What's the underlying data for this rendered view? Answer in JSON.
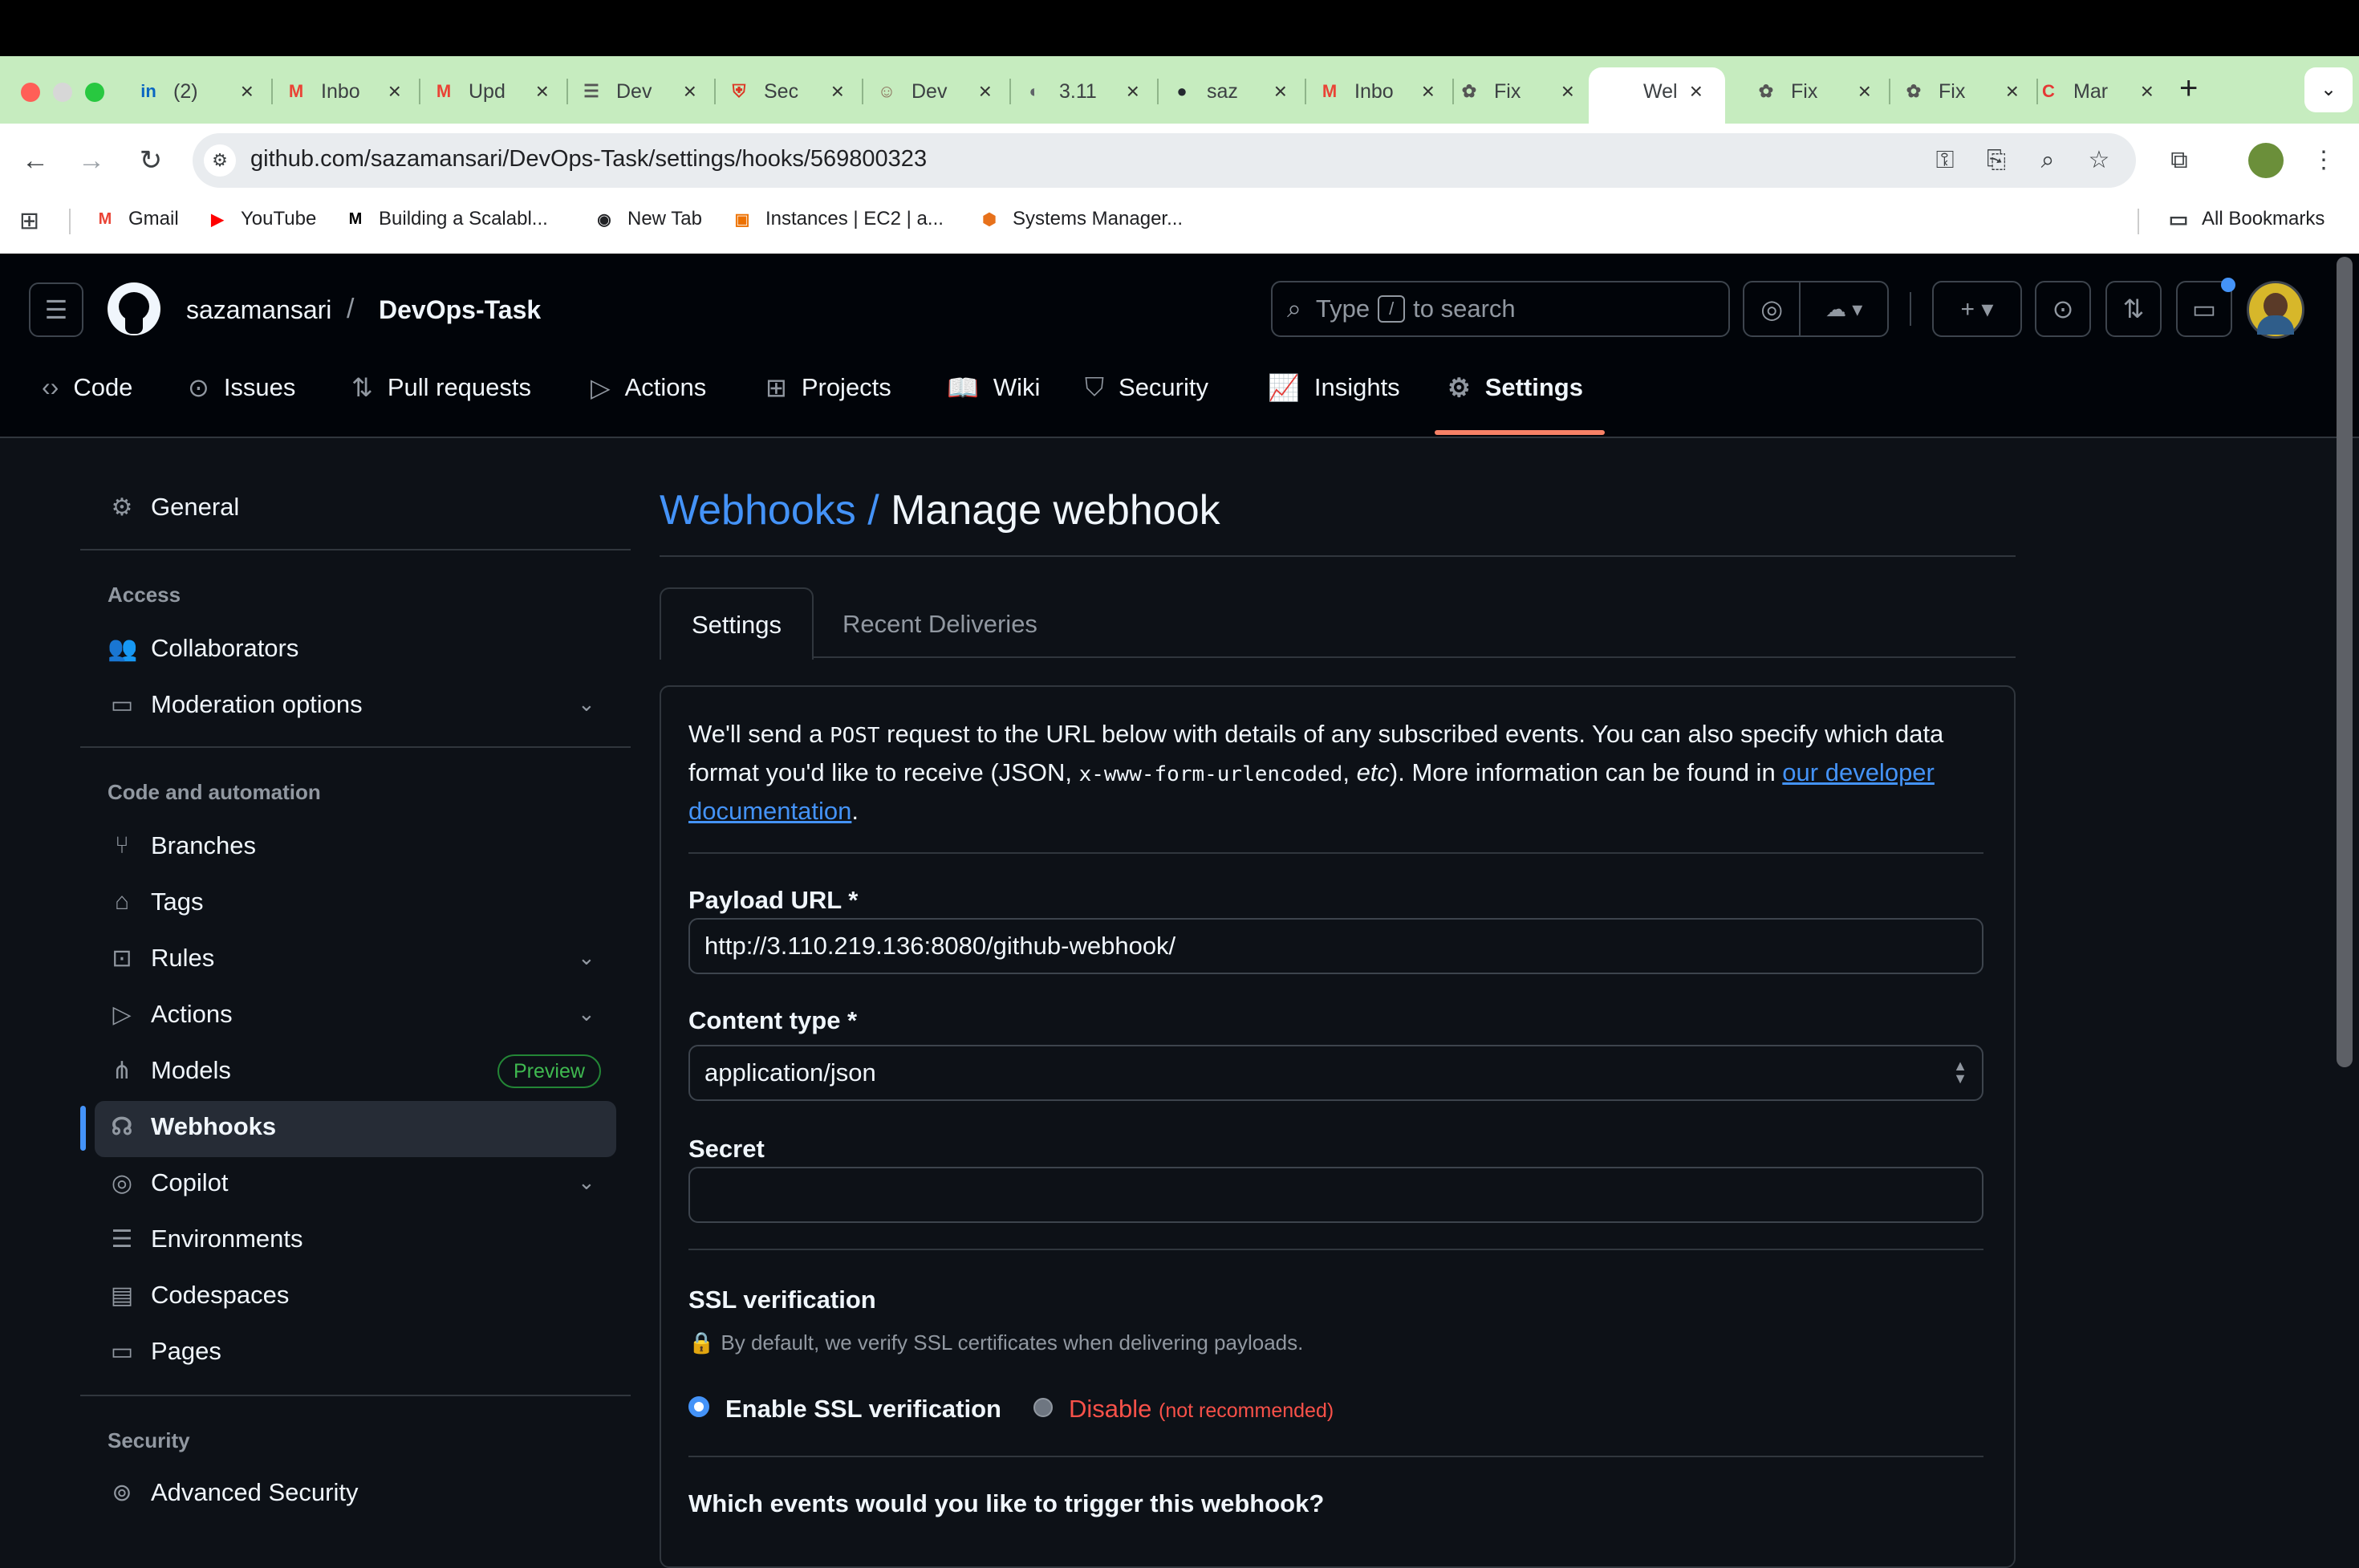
{
  "browser": {
    "tabs": [
      {
        "icon": "linkedin-icon",
        "title": "(2)",
        "color": "#0a66c2",
        "glyph": "in"
      },
      {
        "icon": "gmail-icon",
        "title": "Inbox",
        "color": "#ea4335",
        "glyph": "M"
      },
      {
        "icon": "gmail-icon",
        "title": "Upd",
        "color": "#ea4335",
        "glyph": "M"
      },
      {
        "icon": "checklist-icon",
        "title": "Dev",
        "color": "#555555",
        "glyph": "☰"
      },
      {
        "icon": "aws-security-icon",
        "title": "Sec",
        "color": "#dd3522",
        "glyph": "⛨"
      },
      {
        "icon": "avatar-icon",
        "title": "Dev",
        "color": "#8a6d5a",
        "glyph": "☺"
      },
      {
        "icon": "globe-icon",
        "title": "3.11",
        "color": "#5f6368",
        "glyph": "◐"
      },
      {
        "icon": "github-icon",
        "title": "saz",
        "color": "#24292f",
        "glyph": "●"
      },
      {
        "icon": "gmail-icon",
        "title": "Inbo",
        "color": "#ea4335",
        "glyph": "M"
      },
      {
        "icon": "chatgpt-icon",
        "title": "Fix",
        "color": "#555555",
        "glyph": "✿"
      },
      {
        "icon": "github-icon",
        "title": "Wel",
        "color": "#24292f",
        "glyph": ""
      },
      {
        "icon": "chatgpt-icon",
        "title": "Fix",
        "color": "#555555",
        "glyph": "✿"
      },
      {
        "icon": "chatgpt-icon",
        "title": "Fix",
        "color": "#555555",
        "glyph": "✿"
      },
      {
        "icon": "app-icon",
        "title": "Mar",
        "color": "#e53935",
        "glyph": "C"
      }
    ],
    "url": "github.com/sazamansari/DevOps-Task/settings/hooks/569800323",
    "bookmarks": [
      {
        "label": "Gmail",
        "color": "#ea4335",
        "glyph": "M"
      },
      {
        "label": "YouTube",
        "color": "#ff0000",
        "glyph": "▶"
      },
      {
        "label": "Building a Scalabl...",
        "color": "#000000",
        "glyph": "M"
      },
      {
        "label": "New Tab",
        "color": "#202124",
        "glyph": "◉"
      },
      {
        "label": "Instances | EC2 | a...",
        "color": "#ed7100",
        "glyph": "▣"
      },
      {
        "label": "Systems Manager...",
        "color": "#e7711b",
        "glyph": "⬢"
      }
    ],
    "all_bookmarks": "All Bookmarks"
  },
  "header": {
    "owner": "sazamansari",
    "separator": "/",
    "repo": "DevOps-Task",
    "search_prefix": "Type",
    "search_key": "/",
    "search_suffix": "to search"
  },
  "repo_tabs": [
    {
      "label": "Code",
      "icon": "code-icon",
      "glyph": "‹›"
    },
    {
      "label": "Issues",
      "icon": "issue-icon",
      "glyph": "⊙"
    },
    {
      "label": "Pull requests",
      "icon": "pull-request-icon",
      "glyph": "⇅"
    },
    {
      "label": "Actions",
      "icon": "play-icon",
      "glyph": "▷"
    },
    {
      "label": "Projects",
      "icon": "table-icon",
      "glyph": "⊞"
    },
    {
      "label": "Wiki",
      "icon": "book-icon",
      "glyph": "📖"
    },
    {
      "label": "Security",
      "icon": "shield-icon",
      "glyph": "⛉"
    },
    {
      "label": "Insights",
      "icon": "graph-icon",
      "glyph": "📈"
    },
    {
      "label": "Settings",
      "icon": "gear-icon",
      "glyph": "⚙"
    }
  ],
  "sidebar": {
    "general": "General",
    "access_heading": "Access",
    "collaborators": "Collaborators",
    "moderation": "Moderation options",
    "code_heading": "Code and automation",
    "branches": "Branches",
    "tags": "Tags",
    "rules": "Rules",
    "actions": "Actions",
    "models": "Models",
    "preview_badge": "Preview",
    "webhooks": "Webhooks",
    "copilot": "Copilot",
    "environments": "Environments",
    "codespaces": "Codespaces",
    "pages": "Pages",
    "security_heading": "Security",
    "advanced_security": "Advanced Security"
  },
  "main": {
    "breadcrumb_link": "Webhooks /",
    "title": "Manage webhook",
    "tab_settings": "Settings",
    "tab_deliveries": "Recent Deliveries",
    "intro_1": "We'll send a ",
    "intro_post": "POST",
    "intro_2": " request to the URL below with details of any subscribed events. You can also specify which data format you'd like to receive (JSON, ",
    "intro_code": "x-www-form-urlencoded",
    "intro_3": ", ",
    "intro_etc": "etc",
    "intro_4": "). More information can be found in ",
    "intro_link": "our developer documentation",
    "intro_5": ".",
    "payload_label": "Payload URL *",
    "payload_value": "http://3.110.219.136:8080/github-webhook/",
    "content_type_label": "Content type *",
    "content_type_value": "application/json",
    "secret_label": "Secret",
    "secret_value": "",
    "ssl_heading": "SSL verification",
    "ssl_note": "By default, we verify SSL certificates when delivering payloads.",
    "ssl_enable": "Enable SSL verification",
    "ssl_disable": "Disable",
    "ssl_not_recommended": "(not recommended)",
    "events_heading": "Which events would you like to trigger this webhook?"
  },
  "colors": {
    "accent_blue": "#4493f8",
    "danger": "#f85149",
    "success": "#3fb950",
    "tab_underline": "#f78166"
  }
}
